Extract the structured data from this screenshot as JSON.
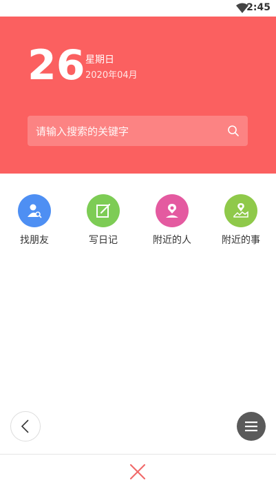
{
  "status_bar": {
    "time": "2:45",
    "wifi_icon": "wifi-icon"
  },
  "header": {
    "day": "26",
    "weekday": "星期日",
    "year_month": "2020年04月",
    "background_color": "#fb6060"
  },
  "search": {
    "placeholder": "请输入搜索的关键字",
    "icon": "search-icon"
  },
  "shortcuts": [
    {
      "label": "找朋友",
      "icon": "find-friend-icon",
      "color": "#4e8ff3"
    },
    {
      "label": "写日记",
      "icon": "write-diary-icon",
      "color": "#7dcc55"
    },
    {
      "label": "附近的人",
      "icon": "nearby-people-icon",
      "color": "#e45aa0"
    },
    {
      "label": "附近的事",
      "icon": "nearby-events-icon",
      "color": "#8fc94a"
    }
  ],
  "controls": {
    "back_icon": "chevron-left-icon",
    "menu_icon": "menu-icon",
    "close_icon": "close-icon",
    "close_color": "#f06a6a"
  }
}
